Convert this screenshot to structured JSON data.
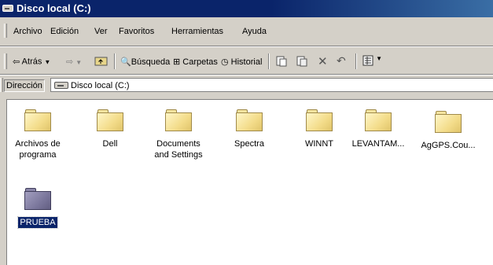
{
  "window": {
    "title": "Disco local (C:)"
  },
  "menu": [
    "Archivo",
    "Edición",
    "Ver",
    "Favoritos",
    "Herramientas",
    "Ayuda"
  ],
  "toolbar": {
    "back": "Atrás",
    "search": "Búsqueda",
    "folders": "Carpetas",
    "history": "Historial"
  },
  "address": {
    "label": "Dirección",
    "value": "Disco local (C:)"
  },
  "files": [
    {
      "line1": "Archivos de",
      "line2": "programa"
    },
    {
      "line1": "Dell",
      "line2": ""
    },
    {
      "line1": "Documents",
      "line2": "and Settings"
    },
    {
      "line1": "Spectra",
      "line2": ""
    },
    {
      "line1": "WINNT",
      "line2": ""
    },
    {
      "line1": "LEVANTAM...",
      "line2": ""
    },
    {
      "line1": "AgGPS.Cou...",
      "line2": ""
    },
    {
      "line1": "PRUEBA",
      "line2": "",
      "selected": true
    }
  ],
  "colors": {
    "title_bar": "#0a246a",
    "folder": "#f3dc8a",
    "selected_folder": "#7b779c",
    "selection": "#0a246a"
  }
}
